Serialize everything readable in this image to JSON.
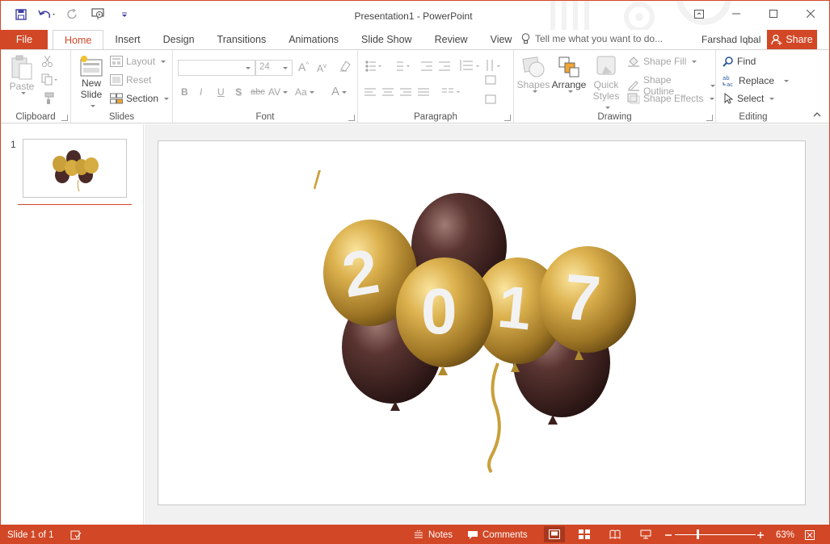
{
  "window": {
    "title": "Presentation1 - PowerPoint"
  },
  "tabs": {
    "file": "File",
    "items": [
      "Home",
      "Insert",
      "Design",
      "Transitions",
      "Animations",
      "Slide Show",
      "Review",
      "View"
    ],
    "tell_me_placeholder": "Tell me what you want to do...",
    "user": "Farshad Iqbal",
    "share": "Share"
  },
  "ribbon": {
    "clipboard": {
      "label": "Clipboard",
      "paste": "Paste"
    },
    "slides": {
      "label": "Slides",
      "new_slide_line1": "New",
      "new_slide_line2": "Slide",
      "layout": "Layout",
      "reset": "Reset",
      "section": "Section"
    },
    "font": {
      "label": "Font",
      "size": "24",
      "bold": "B",
      "italic": "I",
      "underline": "U",
      "shadow": "S",
      "strike": "abc",
      "spacing": "AV",
      "case": "Aa",
      "color": "A",
      "grow": "A",
      "shrink": "A"
    },
    "paragraph": {
      "label": "Paragraph"
    },
    "drawing": {
      "label": "Drawing",
      "shapes": "Shapes",
      "arrange": "Arrange",
      "quick_styles_line1": "Quick",
      "quick_styles_line2": "Styles",
      "shape_fill": "Shape Fill",
      "shape_outline": "Shape Outline",
      "shape_effects": "Shape Effects"
    },
    "editing": {
      "label": "Editing",
      "find": "Find",
      "replace": "Replace",
      "select": "Select"
    }
  },
  "thumbnails": {
    "number": "1"
  },
  "slide": {
    "balloon_digits": [
      "2",
      "0",
      "1",
      "7"
    ]
  },
  "status": {
    "slide_info": "Slide 1 of 1",
    "notes": "Notes",
    "comments": "Comments",
    "zoom": "63%"
  },
  "colors": {
    "accent": "#d24726",
    "balloon_gold": "#c9a03a",
    "balloon_dark": "#4a2a27"
  }
}
